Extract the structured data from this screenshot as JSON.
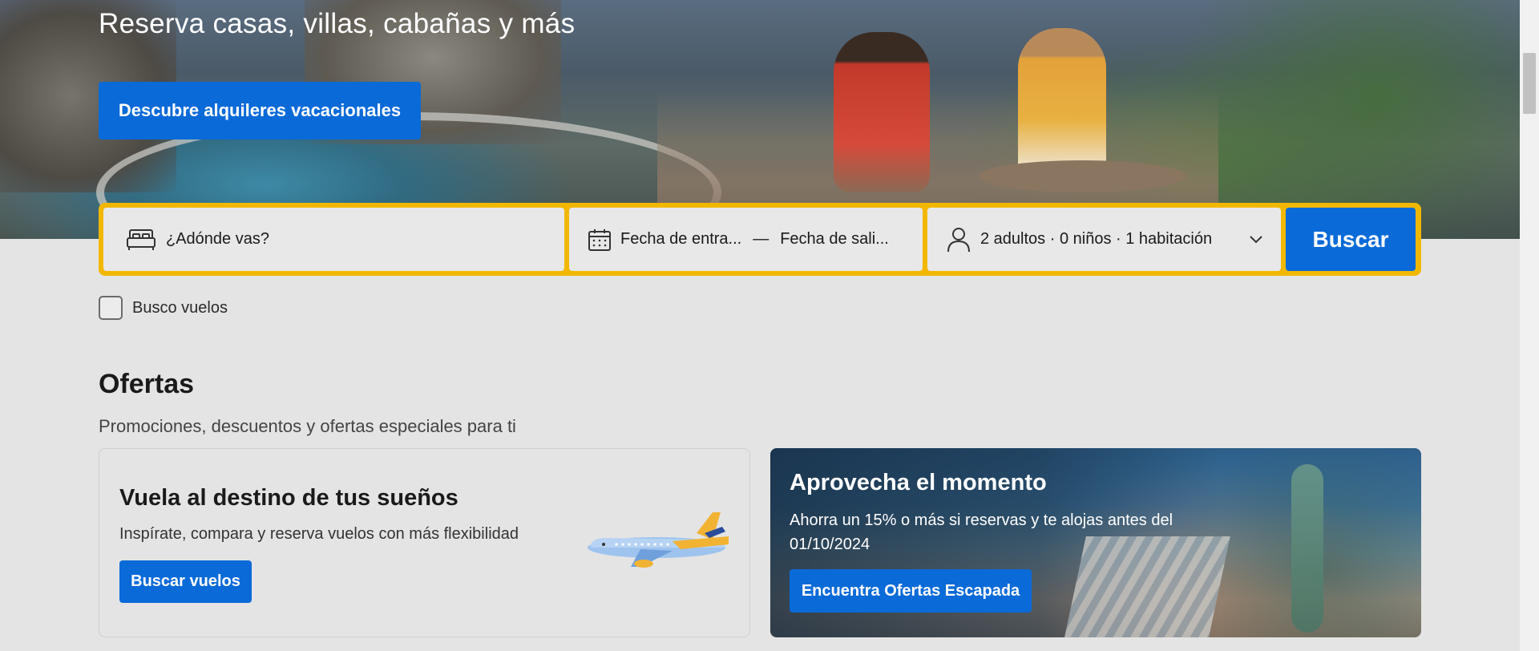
{
  "hero": {
    "tagline": "Reserva casas, villas, cabañas y más",
    "discover_button": "Descubre alquileres vacacionales"
  },
  "search": {
    "destination_placeholder": "¿Adónde vas?",
    "checkin_label": "Fecha de entra...",
    "dash": "—",
    "checkout_label": "Fecha de sali...",
    "guests_label": "2 adultos · 0 niños · 1 habitación",
    "search_button": "Buscar",
    "accent_color": "#f2b800",
    "button_color": "#0a6ad8"
  },
  "flights_checkbox": {
    "label": "Busco vuelos",
    "checked": false
  },
  "offers": {
    "title": "Ofertas",
    "subtitle": "Promociones, descuentos y ofertas especiales para ti",
    "cards": [
      {
        "title": "Vuela al destino de tus sueños",
        "description": "Inspírate, compara y reserva vuelos con más flexibilidad",
        "button": "Buscar vuelos",
        "icon": "airplane-icon"
      },
      {
        "title": "Aprovecha el momento",
        "description": "Ahorra un 15% o más si reservas y te alojas antes del 01/10/2024",
        "button": "Encuentra Ofertas Escapada"
      }
    ]
  },
  "icons": {
    "bed": "bed-icon",
    "calendar": "calendar-icon",
    "person": "person-icon",
    "chevron": "chevron-down-icon"
  }
}
